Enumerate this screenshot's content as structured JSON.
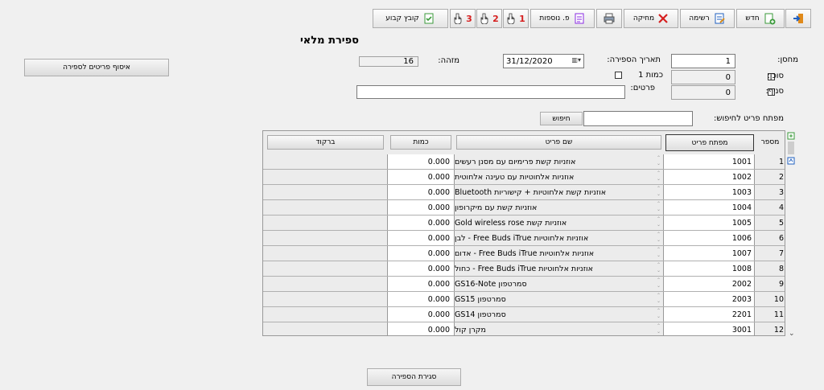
{
  "toolbar": {
    "new_label": "חדש",
    "list_label": "רשימה",
    "delete_label": "מחיקה",
    "more_label": "פ. נוספות",
    "fixed_file_label": "קובץ קבוע",
    "badge1": "1",
    "badge2": "2",
    "badge3": "3"
  },
  "page": {
    "title": "ספירת מלאי"
  },
  "form": {
    "warehouse_label": "מחסן:",
    "warehouse_value": "1",
    "agent_label": "סוכן:",
    "agent_value": "0",
    "branch_label": "סניף:",
    "branch_value": "0",
    "count_date_label": "תאריך הספירה:",
    "count_date_value": "31/12/2020",
    "quantity1_label": "כמות 1",
    "id_label": "מזהה:",
    "id_value": "16",
    "details_label": "פרטים:",
    "details_value": "",
    "search_key_label": "מפתח פריט לחיפוש:",
    "search_key_value": "",
    "search_button": "חיפוש",
    "collect_button": "איסוף פריטים לספירה",
    "close_button": "סגירת הספירה"
  },
  "grid": {
    "headers": {
      "num": "מספר",
      "key": "מפתח פריט",
      "name": "שם פריט",
      "qty": "כמות",
      "barcode": "ברקוד"
    },
    "rows": [
      {
        "num": "1",
        "key": "1001",
        "name": "אוזניות קשת פרימיום עם מסנן רעשים",
        "qty": "0.000",
        "barcode": ""
      },
      {
        "num": "2",
        "key": "1002",
        "name": "אוזניות אלחוטיות עם טעינה אלחוטית",
        "qty": "0.000",
        "barcode": ""
      },
      {
        "num": "3",
        "key": "1003",
        "name": "אוזניות קשת אלחוטיות + קישוריות Bluetooth",
        "qty": "0.000",
        "barcode": ""
      },
      {
        "num": "4",
        "key": "1004",
        "name": "אוזניות קשת עם מיקרופון",
        "qty": "0.000",
        "barcode": ""
      },
      {
        "num": "5",
        "key": "1005",
        "name": "אוזניות קשת Gold wireless rose",
        "qty": "0.000",
        "barcode": ""
      },
      {
        "num": "6",
        "key": "1006",
        "name": "אוזניות אלחוטיות Free Buds iTrue - לבן",
        "qty": "0.000",
        "barcode": ""
      },
      {
        "num": "7",
        "key": "1007",
        "name": "אוזניות אלחוטיות Free Buds iTrue - אדום",
        "qty": "0.000",
        "barcode": ""
      },
      {
        "num": "8",
        "key": "1008",
        "name": "אוזניות אלחוטיות Free Buds iTrue - כחול",
        "qty": "0.000",
        "barcode": ""
      },
      {
        "num": "9",
        "key": "2002",
        "name": "סמרטפון GS16-Note",
        "qty": "0.000",
        "barcode": ""
      },
      {
        "num": "10",
        "key": "2003",
        "name": "סמרטפון GS15",
        "qty": "0.000",
        "barcode": ""
      },
      {
        "num": "11",
        "key": "2201",
        "name": "סמרטפון GS14",
        "qty": "0.000",
        "barcode": ""
      },
      {
        "num": "12",
        "key": "3001",
        "name": "מקרן קול",
        "qty": "0.000",
        "barcode": ""
      }
    ]
  },
  "colors": {
    "accent_red": "#d61f1f",
    "accent_green": "#3a9a3a",
    "accent_blue": "#1f5fbf",
    "accent_purple": "#8a2be2"
  }
}
